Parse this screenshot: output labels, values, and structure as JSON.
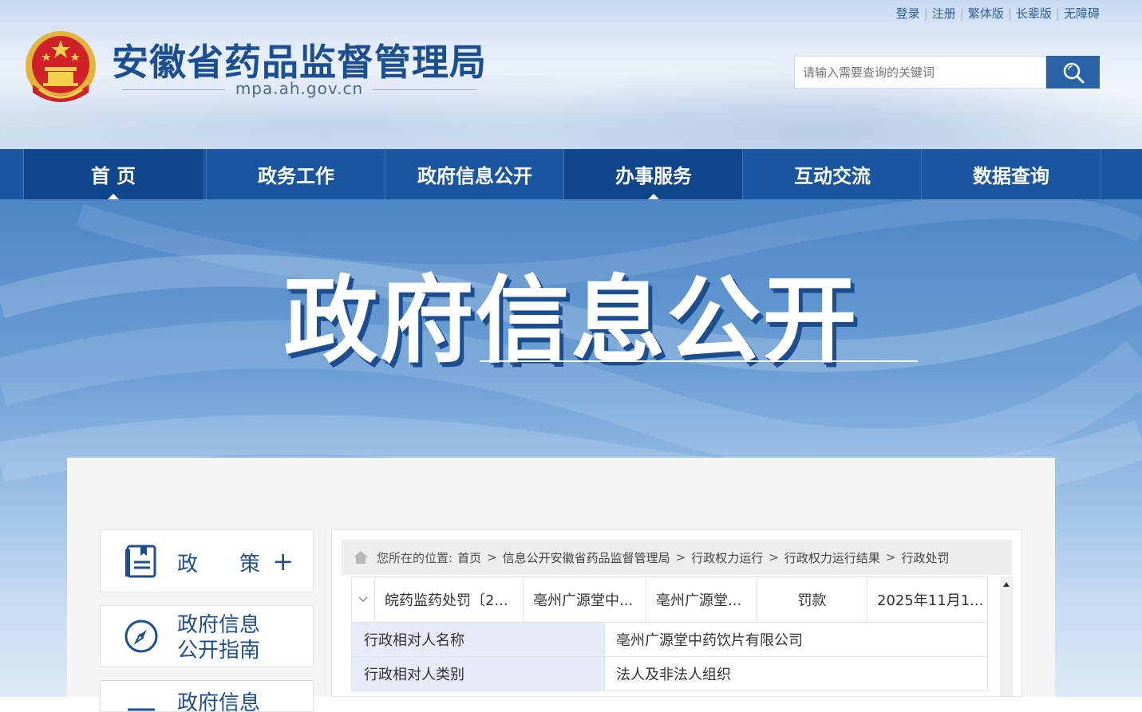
{
  "top_links": [
    "登录",
    "注册",
    "繁体版",
    "长辈版",
    "无障碍"
  ],
  "site": {
    "title": "安徽省药品监督管理局",
    "domain": "mpa.ah.gov.cn"
  },
  "search": {
    "placeholder": "请输入需要查询的关键词"
  },
  "nav": {
    "items": [
      {
        "label": "首 页"
      },
      {
        "label": "政务工作"
      },
      {
        "label": "政府信息公开"
      },
      {
        "label": "办事服务"
      },
      {
        "label": "互动交流"
      },
      {
        "label": "数据查询"
      }
    ]
  },
  "banner": {
    "title": "政府信息公开"
  },
  "sidebar": {
    "items": [
      {
        "label": "政　　策"
      },
      {
        "label_line1": "政府信息",
        "label_line2": "公开指南"
      },
      {
        "label_line1": "政府信息"
      }
    ]
  },
  "breadcrumb": {
    "prefix": "您所在的位置:",
    "items": [
      "首页",
      "信息公开安徽省药品监督管理局",
      "行政权力运行",
      "行政权力运行结果",
      "行政处罚"
    ],
    "separator": ">"
  },
  "record": {
    "cells": [
      "皖药监药处罚〔2...",
      "亳州广源堂中...",
      "亳州广源堂...",
      "罚款",
      "2025年11月1..."
    ],
    "details": [
      {
        "key": "行政相对人名称",
        "value": "亳州广源堂中药饮片有限公司"
      },
      {
        "key": "行政相对人类别",
        "value": "法人及非法人组织"
      }
    ]
  },
  "colors": {
    "primary_blue": "#1a56a0",
    "active_nav": "#10468c",
    "title_blue": "#1c4f91",
    "detail_key_bg": "#e7eaf7"
  }
}
